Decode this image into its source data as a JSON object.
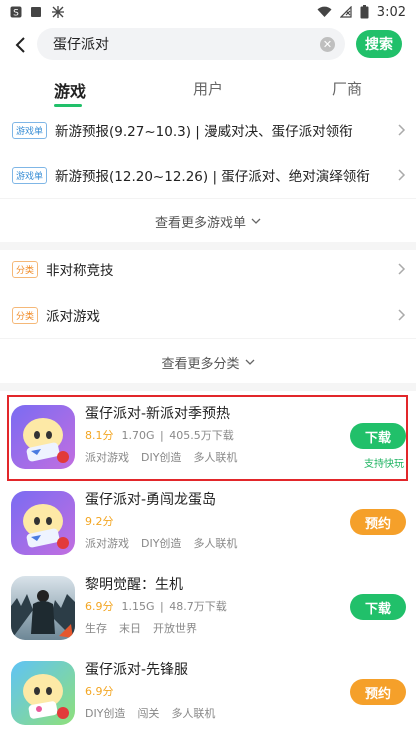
{
  "status_bar": {
    "time": "3:02",
    "left_icons": [
      "s-box-icon",
      "square-icon",
      "firework-icon"
    ],
    "right_icons": [
      "wifi-icon",
      "no-signal-icon",
      "battery-icon"
    ]
  },
  "search": {
    "value": "蛋仔派对",
    "button": "搜索"
  },
  "tabs": [
    {
      "label": "游戏",
      "active": true
    },
    {
      "label": "用户",
      "active": false
    },
    {
      "label": "厂商",
      "active": false
    }
  ],
  "game_lists": {
    "tag": "游戏单",
    "items": [
      "新游预报(9.27~10.3) | 漫威对决、蛋仔派对领衔",
      "新游预报(12.20~12.26) | 蛋仔派对、绝对演绎领衔"
    ],
    "more": "查看更多游戏单"
  },
  "categories": {
    "tag": "分类",
    "items": [
      "非对称竞技",
      "派对游戏"
    ],
    "more": "查看更多分类"
  },
  "games": [
    {
      "name": "蛋仔派对-新派对季预热",
      "score": "8.1分",
      "size": "1.70G",
      "downloads": "405.5万下载",
      "tags": [
        "派对游戏",
        "DIY创造",
        "多人联机"
      ],
      "action": "下载",
      "action_color": "#21c06a",
      "extra": "支持快玩"
    },
    {
      "name": "蛋仔派对-勇闯龙蛋岛",
      "score": "9.2分",
      "size": "",
      "downloads": "",
      "tags": [
        "派对游戏",
        "DIY创造",
        "多人联机"
      ],
      "action": "预约",
      "action_color": "#f5a02a",
      "extra": ""
    },
    {
      "name": "黎明觉醒：生机",
      "score": "6.9分",
      "size": "1.15G",
      "downloads": "48.7万下载",
      "tags": [
        "生存",
        "末日",
        "开放世界"
      ],
      "action": "下载",
      "action_color": "#21c06a",
      "extra": ""
    },
    {
      "name": "蛋仔派对-先锋服",
      "score": "6.9分",
      "size": "",
      "downloads": "",
      "tags": [
        "DIY创造",
        "闯关",
        "多人联机"
      ],
      "action": "预约",
      "action_color": "#f5a02a",
      "extra": ""
    }
  ]
}
